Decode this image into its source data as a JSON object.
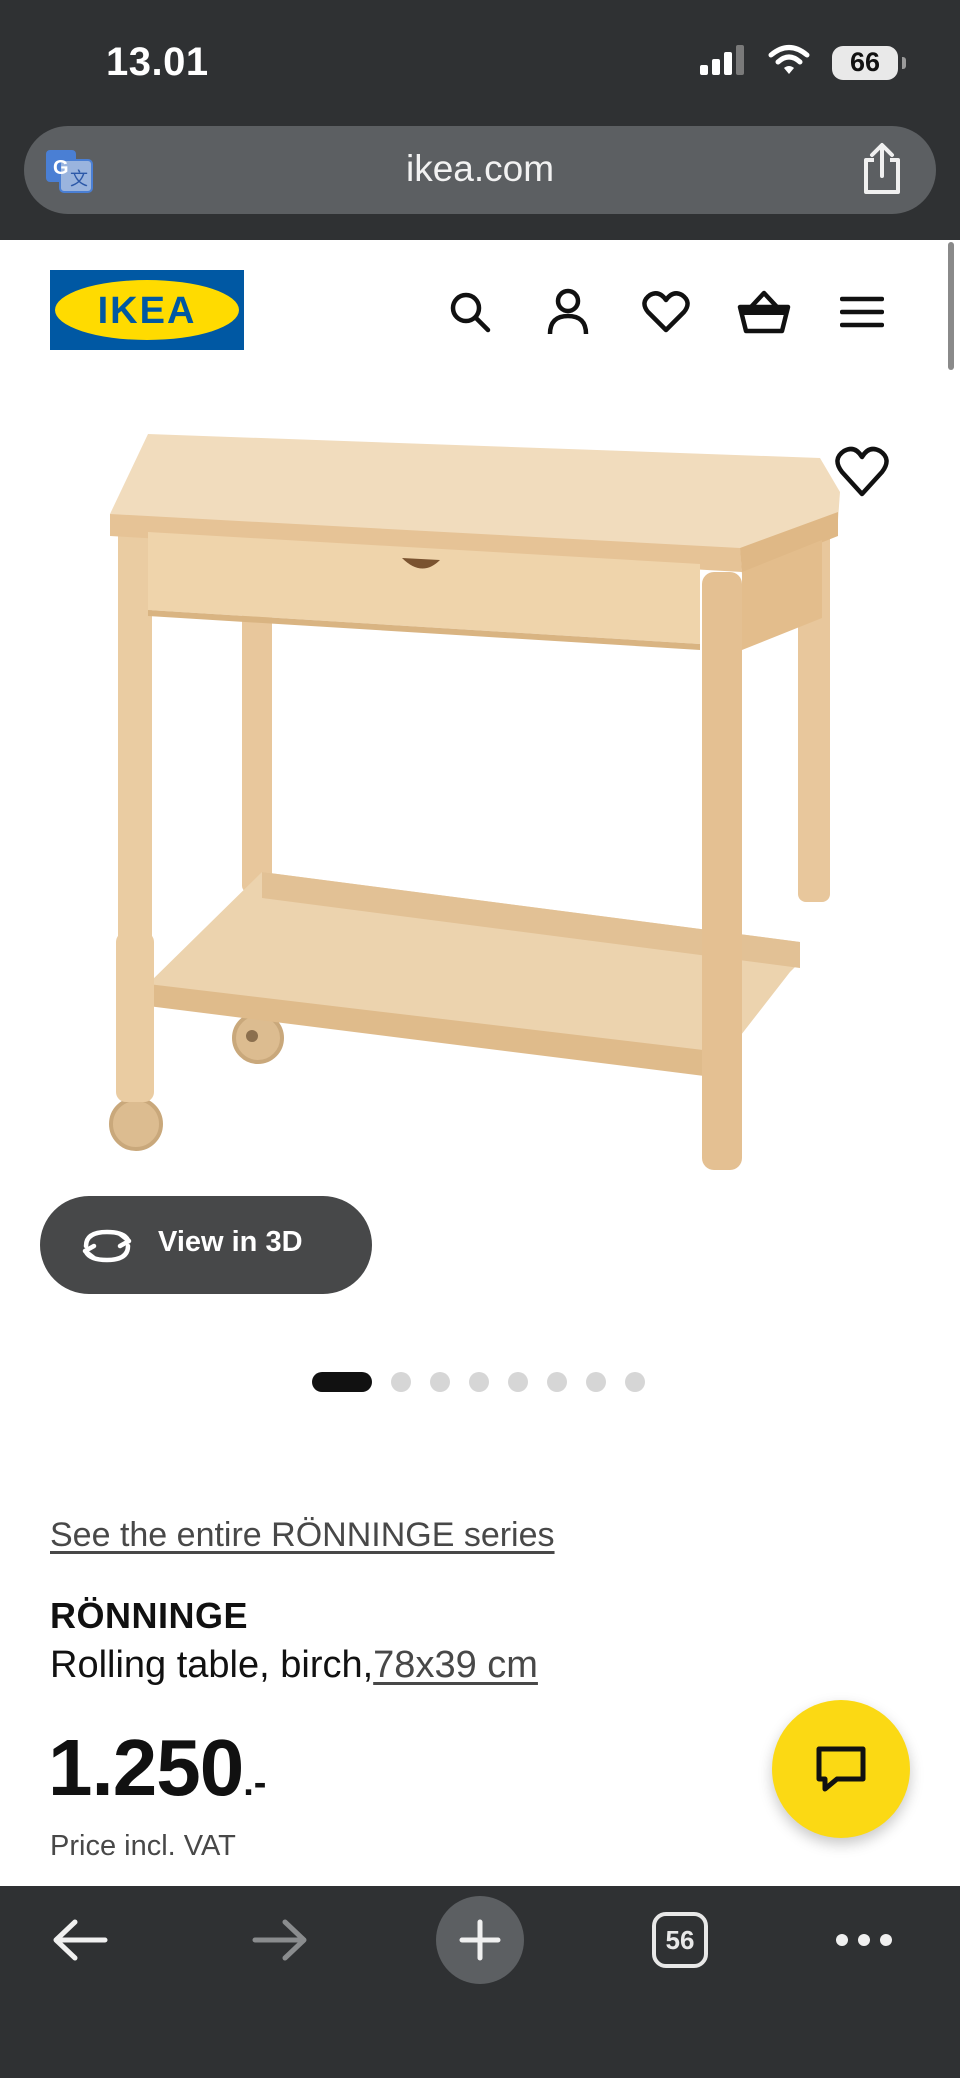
{
  "status_bar": {
    "time": "13.01",
    "battery": "66",
    "icons": [
      "signal-icon",
      "wifi-icon",
      "battery-icon"
    ]
  },
  "browser": {
    "url": "ikea.com",
    "icons": [
      "translate-icon",
      "share-icon"
    ],
    "toolbar": {
      "icons": [
        "back-arrow-icon",
        "forward-arrow-icon",
        "plus-icon",
        "tabs-icon",
        "more-icon"
      ],
      "tab_count": "56"
    }
  },
  "header": {
    "logo": "IKEA",
    "icons": [
      "search-icon",
      "account-icon",
      "heart-icon",
      "basket-icon",
      "menu-icon"
    ]
  },
  "product": {
    "view3d_label": "View in 3D",
    "carousel": {
      "total": 8,
      "active": 1
    },
    "series_link": "See the entire RÖNNINGE series",
    "name": "RÖNNINGE",
    "description": "Rolling table, birch,",
    "size": "78x39 cm",
    "price": "1.250",
    "price_suffix": ".-",
    "price_note": "Price incl. VAT"
  },
  "colors": {
    "chrome": "#2f3133",
    "ikea_blue": "#0058a3",
    "ikea_yellow": "#ffdb00",
    "chat_yellow": "#fbd914"
  }
}
